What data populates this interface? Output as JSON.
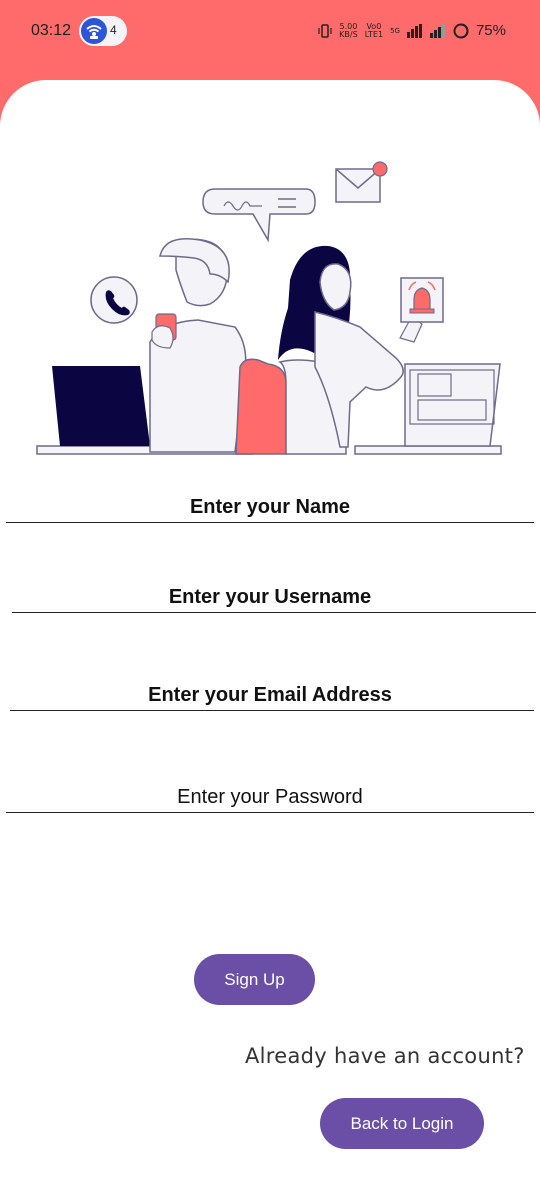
{
  "status_bar": {
    "time": "03:12",
    "notification_count": "4",
    "network_speed_value": "5.00",
    "network_speed_unit": "KB/S",
    "volte_top": "Vo0",
    "volte_bottom": "LTE1",
    "network_type": "5G",
    "battery": "75%"
  },
  "form": {
    "name_placeholder": "Enter your Name",
    "username_placeholder": "Enter your Username",
    "email_placeholder": "Enter your Email Address",
    "password_placeholder": "Enter your Password"
  },
  "actions": {
    "signup_label": "Sign Up",
    "already_text": "Already have an account?",
    "back_label": "Back to Login"
  },
  "colors": {
    "header": "#ff6b6b",
    "accent": "#6b4fa6",
    "illustration_dark": "#0b0541",
    "illustration_red": "#ff6b6b"
  },
  "icons": {
    "wifi": "wifi-icon",
    "vibrate": "vibrate-icon",
    "signal": "signal-icon",
    "battery": "battery-icon",
    "phone": "phone-icon",
    "mail": "mail-icon",
    "bell": "bell-icon"
  }
}
